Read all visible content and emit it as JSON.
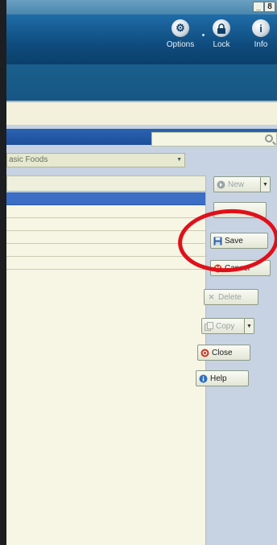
{
  "window": {
    "minimize_glyph": "_",
    "restore_glyph": "8"
  },
  "header": {
    "options": {
      "label": "Options",
      "icon": "gear-icon"
    },
    "lock": {
      "label": "Lock",
      "icon": "lock-icon"
    },
    "info": {
      "label": "Info",
      "icon": "info-icon"
    }
  },
  "panel": {
    "category_select": {
      "value": "asic Foods"
    }
  },
  "actions": {
    "new": {
      "label": "New",
      "icon": "new-icon",
      "enabled": false
    },
    "save": {
      "label": "Save",
      "icon": "save-icon",
      "enabled": true
    },
    "cancel": {
      "label": "Cancel",
      "icon": "cancel-icon",
      "enabled": true
    },
    "delete": {
      "label": "Delete",
      "icon": "delete-icon",
      "enabled": false
    },
    "copy": {
      "label": "Copy",
      "icon": "copy-icon",
      "enabled": false
    },
    "close": {
      "label": "Close",
      "icon": "close-icon",
      "enabled": true
    },
    "help": {
      "label": "Help",
      "icon": "help-icon",
      "enabled": true
    }
  },
  "colors": {
    "header": "#0f4c7e",
    "selection": "#3b6ec4",
    "highlight_ring": "#e0101a"
  }
}
